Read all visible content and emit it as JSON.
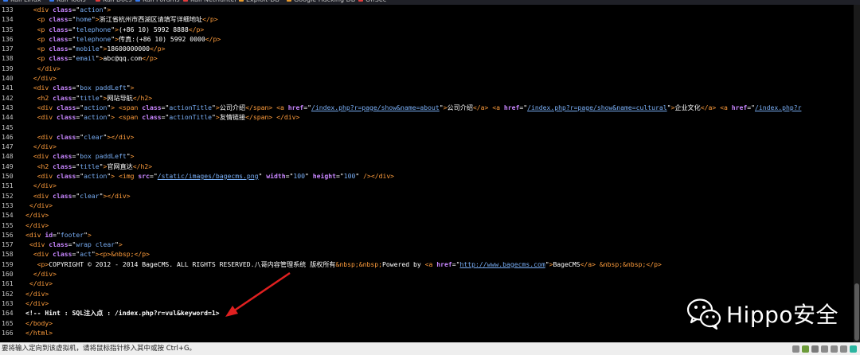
{
  "bookmarks": [
    {
      "label": "Kali Linux",
      "color": "#367bf0"
    },
    {
      "label": "Kali Tools",
      "color": "#367bf0"
    },
    {
      "label": "Kali Docs",
      "color": "#e23c3c"
    },
    {
      "label": "Kali Forums",
      "color": "#367bf0"
    },
    {
      "label": "Kali NetHunter",
      "color": "#e23c3c"
    },
    {
      "label": "Exploit-DB",
      "color": "#e89a2b"
    },
    {
      "label": "Google Hacking DB",
      "color": "#e89a2b"
    },
    {
      "label": "OffSec",
      "color": "#e23c3c"
    }
  ],
  "source_lines": [
    {
      "n": "133",
      "s": [
        [
          "t",
          "  "
        ],
        [
          "g",
          "<div "
        ],
        [
          "a",
          "class"
        ],
        [
          "t",
          "=\""
        ],
        [
          "v",
          "action"
        ],
        [
          "t",
          "\""
        ],
        [
          "g",
          ">"
        ]
      ]
    },
    {
      "n": "134",
      "s": [
        [
          "t",
          "   "
        ],
        [
          "g",
          "<p "
        ],
        [
          "a",
          "class"
        ],
        [
          "t",
          "=\""
        ],
        [
          "v",
          "home"
        ],
        [
          "t",
          "\""
        ],
        [
          "g",
          ">"
        ],
        [
          "t",
          "浙江省杭州市西湖区请填写详细地址"
        ],
        [
          "g",
          "</p>"
        ]
      ]
    },
    {
      "n": "135",
      "s": [
        [
          "t",
          "   "
        ],
        [
          "g",
          "<p "
        ],
        [
          "a",
          "class"
        ],
        [
          "t",
          "=\""
        ],
        [
          "v",
          "telephone"
        ],
        [
          "t",
          "\""
        ],
        [
          "g",
          ">"
        ],
        [
          "t",
          "(+86 10) 5992 8888"
        ],
        [
          "g",
          "</p>"
        ]
      ]
    },
    {
      "n": "136",
      "s": [
        [
          "t",
          "   "
        ],
        [
          "g",
          "<p "
        ],
        [
          "a",
          "class"
        ],
        [
          "t",
          "=\""
        ],
        [
          "v",
          "telephone"
        ],
        [
          "t",
          "\""
        ],
        [
          "g",
          ">"
        ],
        [
          "t",
          "传真:(+86 10) 5992 0000"
        ],
        [
          "g",
          "</p>"
        ]
      ]
    },
    {
      "n": "137",
      "s": [
        [
          "t",
          "   "
        ],
        [
          "g",
          "<p "
        ],
        [
          "a",
          "class"
        ],
        [
          "t",
          "=\""
        ],
        [
          "v",
          "mobile"
        ],
        [
          "t",
          "\""
        ],
        [
          "g",
          ">"
        ],
        [
          "t",
          "18600000000"
        ],
        [
          "g",
          "</p>"
        ]
      ]
    },
    {
      "n": "138",
      "s": [
        [
          "t",
          "   "
        ],
        [
          "g",
          "<p "
        ],
        [
          "a",
          "class"
        ],
        [
          "t",
          "=\""
        ],
        [
          "v",
          "email"
        ],
        [
          "t",
          "\""
        ],
        [
          "g",
          ">"
        ],
        [
          "t",
          "abc@qq.com"
        ],
        [
          "g",
          "</p>"
        ]
      ]
    },
    {
      "n": "139",
      "s": [
        [
          "t",
          "   "
        ],
        [
          "g",
          "</div>"
        ]
      ]
    },
    {
      "n": "140",
      "s": [
        [
          "t",
          "  "
        ],
        [
          "g",
          "</div>"
        ]
      ]
    },
    {
      "n": "141",
      "s": [
        [
          "t",
          "  "
        ],
        [
          "g",
          "<div "
        ],
        [
          "a",
          "class"
        ],
        [
          "t",
          "=\""
        ],
        [
          "v",
          "box paddLeft"
        ],
        [
          "t",
          "\""
        ],
        [
          "g",
          ">"
        ]
      ]
    },
    {
      "n": "142",
      "s": [
        [
          "t",
          "   "
        ],
        [
          "g",
          "<h2 "
        ],
        [
          "a",
          "class"
        ],
        [
          "t",
          "=\""
        ],
        [
          "v",
          "title"
        ],
        [
          "t",
          "\""
        ],
        [
          "g",
          ">"
        ],
        [
          "t",
          "网站导航"
        ],
        [
          "g",
          "</h2>"
        ]
      ]
    },
    {
      "n": "143",
      "s": [
        [
          "t",
          "   "
        ],
        [
          "g",
          "<div "
        ],
        [
          "a",
          "class"
        ],
        [
          "t",
          "=\""
        ],
        [
          "v",
          "action"
        ],
        [
          "t",
          "\""
        ],
        [
          "g",
          "> <span "
        ],
        [
          "a",
          "class"
        ],
        [
          "t",
          "=\""
        ],
        [
          "v",
          "actionTitle"
        ],
        [
          "t",
          "\""
        ],
        [
          "g",
          ">"
        ],
        [
          "t",
          "公司介绍"
        ],
        [
          "g",
          "</span> <a "
        ],
        [
          "a",
          "href"
        ],
        [
          "t",
          "=\""
        ],
        [
          "u",
          "/index.php?r=page/show&name=about"
        ],
        [
          "t",
          "\""
        ],
        [
          "g",
          ">"
        ],
        [
          "t",
          "公司介绍"
        ],
        [
          "g",
          "</a> <a "
        ],
        [
          "a",
          "href"
        ],
        [
          "t",
          "=\""
        ],
        [
          "u",
          "/index.php?r=page/show&name=cultural"
        ],
        [
          "t",
          "\""
        ],
        [
          "g",
          ">"
        ],
        [
          "t",
          "企业文化"
        ],
        [
          "g",
          "</a> <a "
        ],
        [
          "a",
          "href"
        ],
        [
          "t",
          "=\""
        ],
        [
          "u",
          "/index.php?r"
        ]
      ]
    },
    {
      "n": "144",
      "s": [
        [
          "t",
          "   "
        ],
        [
          "g",
          "<div "
        ],
        [
          "a",
          "class"
        ],
        [
          "t",
          "=\""
        ],
        [
          "v",
          "action"
        ],
        [
          "t",
          "\""
        ],
        [
          "g",
          "> <span "
        ],
        [
          "a",
          "class"
        ],
        [
          "t",
          "=\""
        ],
        [
          "v",
          "actionTitle"
        ],
        [
          "t",
          "\""
        ],
        [
          "g",
          ">"
        ],
        [
          "t",
          "友情链接"
        ],
        [
          "g",
          "</span> </div>"
        ]
      ]
    },
    {
      "n": "145",
      "s": [
        [
          "t",
          ""
        ]
      ]
    },
    {
      "n": "146",
      "s": [
        [
          "t",
          "   "
        ],
        [
          "g",
          "<div "
        ],
        [
          "a",
          "class"
        ],
        [
          "t",
          "=\""
        ],
        [
          "v",
          "clear"
        ],
        [
          "t",
          "\""
        ],
        [
          "g",
          "></div>"
        ]
      ]
    },
    {
      "n": "147",
      "s": [
        [
          "t",
          "  "
        ],
        [
          "g",
          "</div>"
        ]
      ]
    },
    {
      "n": "148",
      "s": [
        [
          "t",
          "  "
        ],
        [
          "g",
          "<div "
        ],
        [
          "a",
          "class"
        ],
        [
          "t",
          "=\""
        ],
        [
          "v",
          "box paddLeft"
        ],
        [
          "t",
          "\""
        ],
        [
          "g",
          ">"
        ]
      ]
    },
    {
      "n": "149",
      "s": [
        [
          "t",
          "   "
        ],
        [
          "g",
          "<h2 "
        ],
        [
          "a",
          "class"
        ],
        [
          "t",
          "=\""
        ],
        [
          "v",
          "title"
        ],
        [
          "t",
          "\""
        ],
        [
          "g",
          ">"
        ],
        [
          "t",
          "官网直达"
        ],
        [
          "g",
          "</h2>"
        ]
      ]
    },
    {
      "n": "150",
      "s": [
        [
          "t",
          "   "
        ],
        [
          "g",
          "<div "
        ],
        [
          "a",
          "class"
        ],
        [
          "t",
          "=\""
        ],
        [
          "v",
          "action"
        ],
        [
          "t",
          "\""
        ],
        [
          "g",
          "> <img "
        ],
        [
          "a",
          "src"
        ],
        [
          "t",
          "=\""
        ],
        [
          "u",
          "/static/images/bagecms.png"
        ],
        [
          "t",
          "\" "
        ],
        [
          "a",
          "width"
        ],
        [
          "t",
          "=\""
        ],
        [
          "v",
          "100"
        ],
        [
          "t",
          "\" "
        ],
        [
          "a",
          "height"
        ],
        [
          "t",
          "=\""
        ],
        [
          "v",
          "100"
        ],
        [
          "t",
          "\""
        ],
        [
          "g",
          " /></div>"
        ]
      ]
    },
    {
      "n": "151",
      "s": [
        [
          "t",
          "  "
        ],
        [
          "g",
          "</div>"
        ]
      ]
    },
    {
      "n": "152",
      "s": [
        [
          "t",
          "  "
        ],
        [
          "g",
          "<div "
        ],
        [
          "a",
          "class"
        ],
        [
          "t",
          "=\""
        ],
        [
          "v",
          "clear"
        ],
        [
          "t",
          "\""
        ],
        [
          "g",
          "></div>"
        ]
      ]
    },
    {
      "n": "153",
      "s": [
        [
          "t",
          " "
        ],
        [
          "g",
          "</div>"
        ]
      ]
    },
    {
      "n": "154",
      "s": [
        [
          "g",
          "</div>"
        ]
      ]
    },
    {
      "n": "155",
      "s": [
        [
          "g",
          "</div>"
        ]
      ]
    },
    {
      "n": "156",
      "s": [
        [
          "g",
          "<div "
        ],
        [
          "a",
          "id"
        ],
        [
          "t",
          "=\""
        ],
        [
          "v",
          "footer"
        ],
        [
          "t",
          "\""
        ],
        [
          "g",
          ">"
        ]
      ]
    },
    {
      "n": "157",
      "s": [
        [
          "t",
          " "
        ],
        [
          "g",
          "<div "
        ],
        [
          "a",
          "class"
        ],
        [
          "t",
          "=\""
        ],
        [
          "v",
          "wrap clear"
        ],
        [
          "t",
          "\""
        ],
        [
          "g",
          ">"
        ]
      ]
    },
    {
      "n": "158",
      "s": [
        [
          "t",
          "  "
        ],
        [
          "g",
          "<div "
        ],
        [
          "a",
          "class"
        ],
        [
          "t",
          "=\""
        ],
        [
          "v",
          "act"
        ],
        [
          "t",
          "\""
        ],
        [
          "g",
          "><p>"
        ],
        [
          "e",
          "&nbsp;"
        ],
        [
          "g",
          "</p>"
        ]
      ]
    },
    {
      "n": "159",
      "s": [
        [
          "t",
          "   "
        ],
        [
          "g",
          "<p>"
        ],
        [
          "t",
          "COPYRIGHT © 2012 - 2014 BageCMS. ALL RIGHTS RESERVED.八哥内容管理系统 版权所有"
        ],
        [
          "e",
          "&nbsp;&nbsp;"
        ],
        [
          "t",
          "Powered by "
        ],
        [
          "g",
          "<a "
        ],
        [
          "a",
          "href"
        ],
        [
          "t",
          "=\""
        ],
        [
          "u",
          "http://www.bagecms.com"
        ],
        [
          "t",
          "\""
        ],
        [
          "g",
          ">"
        ],
        [
          "t",
          "BageCMS"
        ],
        [
          "g",
          "</a> "
        ],
        [
          "e",
          "&nbsp;&nbsp;"
        ],
        [
          "g",
          "</p>"
        ]
      ]
    },
    {
      "n": "160",
      "s": [
        [
          "t",
          "  "
        ],
        [
          "g",
          "</div>"
        ]
      ]
    },
    {
      "n": "161",
      "s": [
        [
          "t",
          " "
        ],
        [
          "g",
          "</div>"
        ]
      ]
    },
    {
      "n": "162",
      "s": [
        [
          "g",
          "</div>"
        ]
      ]
    },
    {
      "n": "163",
      "s": [
        [
          "g",
          "</div>"
        ]
      ]
    },
    {
      "n": "164",
      "s": [
        [
          "c",
          "<!-- Hint : SQL注入点 : /index.php?r=vul&keyword=1>"
        ]
      ]
    },
    {
      "n": "165",
      "s": [
        [
          "g",
          "</body>"
        ]
      ]
    },
    {
      "n": "166",
      "s": [
        [
          "g",
          "</html>"
        ]
      ]
    }
  ],
  "status_message": "要将输入定向到该虚拟机，请将鼠标指针移入其中或按 Ctrl+G。",
  "watermark": {
    "text": "Hippo安全",
    "icon": "wechat-icon"
  },
  "annotation": {
    "type": "arrow",
    "color": "#e02020"
  },
  "colors": {
    "tag": "#ff9d3c",
    "attr": "#c886ff",
    "value": "#79aef5",
    "text": "#ffffff",
    "background": "#000000"
  }
}
